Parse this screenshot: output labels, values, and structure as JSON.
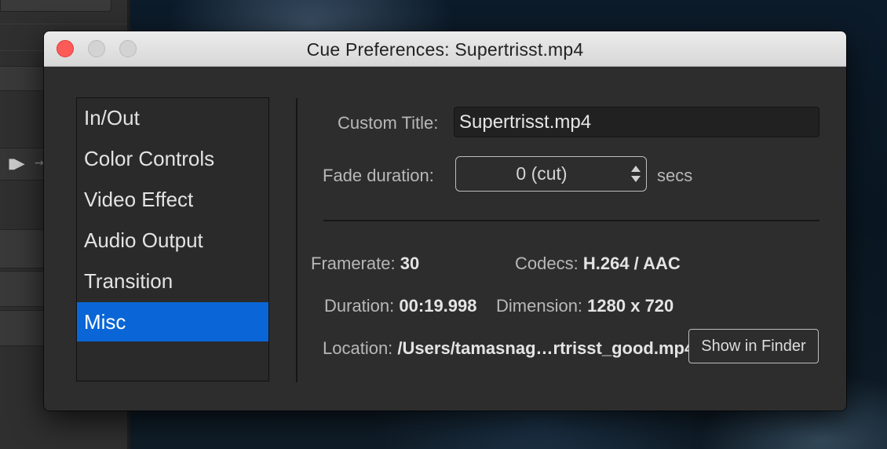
{
  "window": {
    "title": "Cue Preferences: Supertrisst.mp4"
  },
  "sidebar": {
    "items": [
      {
        "label": "In/Out"
      },
      {
        "label": "Color Controls"
      },
      {
        "label": "Video Effect"
      },
      {
        "label": "Audio Output"
      },
      {
        "label": "Transition"
      },
      {
        "label": "Misc",
        "selected": true
      }
    ]
  },
  "misc": {
    "custom_title_label": "Custom Title:",
    "custom_title_value": "Supertrisst.mp4",
    "fade_duration_label": "Fade duration:",
    "fade_duration_value": "0 (cut)",
    "fade_duration_unit": "secs",
    "framerate_label": "Framerate:",
    "framerate_value": "30",
    "codecs_label": "Codecs:",
    "codecs_value": "H.264 / AAC",
    "duration_label": "Duration:",
    "duration_value": "00:19.998",
    "dimension_label": "Dimension:",
    "dimension_value": "1280 x 720",
    "location_label": "Location:",
    "location_value": "/Users/tamasnag…rtrisst_good.mp4",
    "show_in_finder_label": "Show in Finder"
  },
  "colors": {
    "selection": "#0a66d6",
    "close_button": "#fc5b57"
  }
}
